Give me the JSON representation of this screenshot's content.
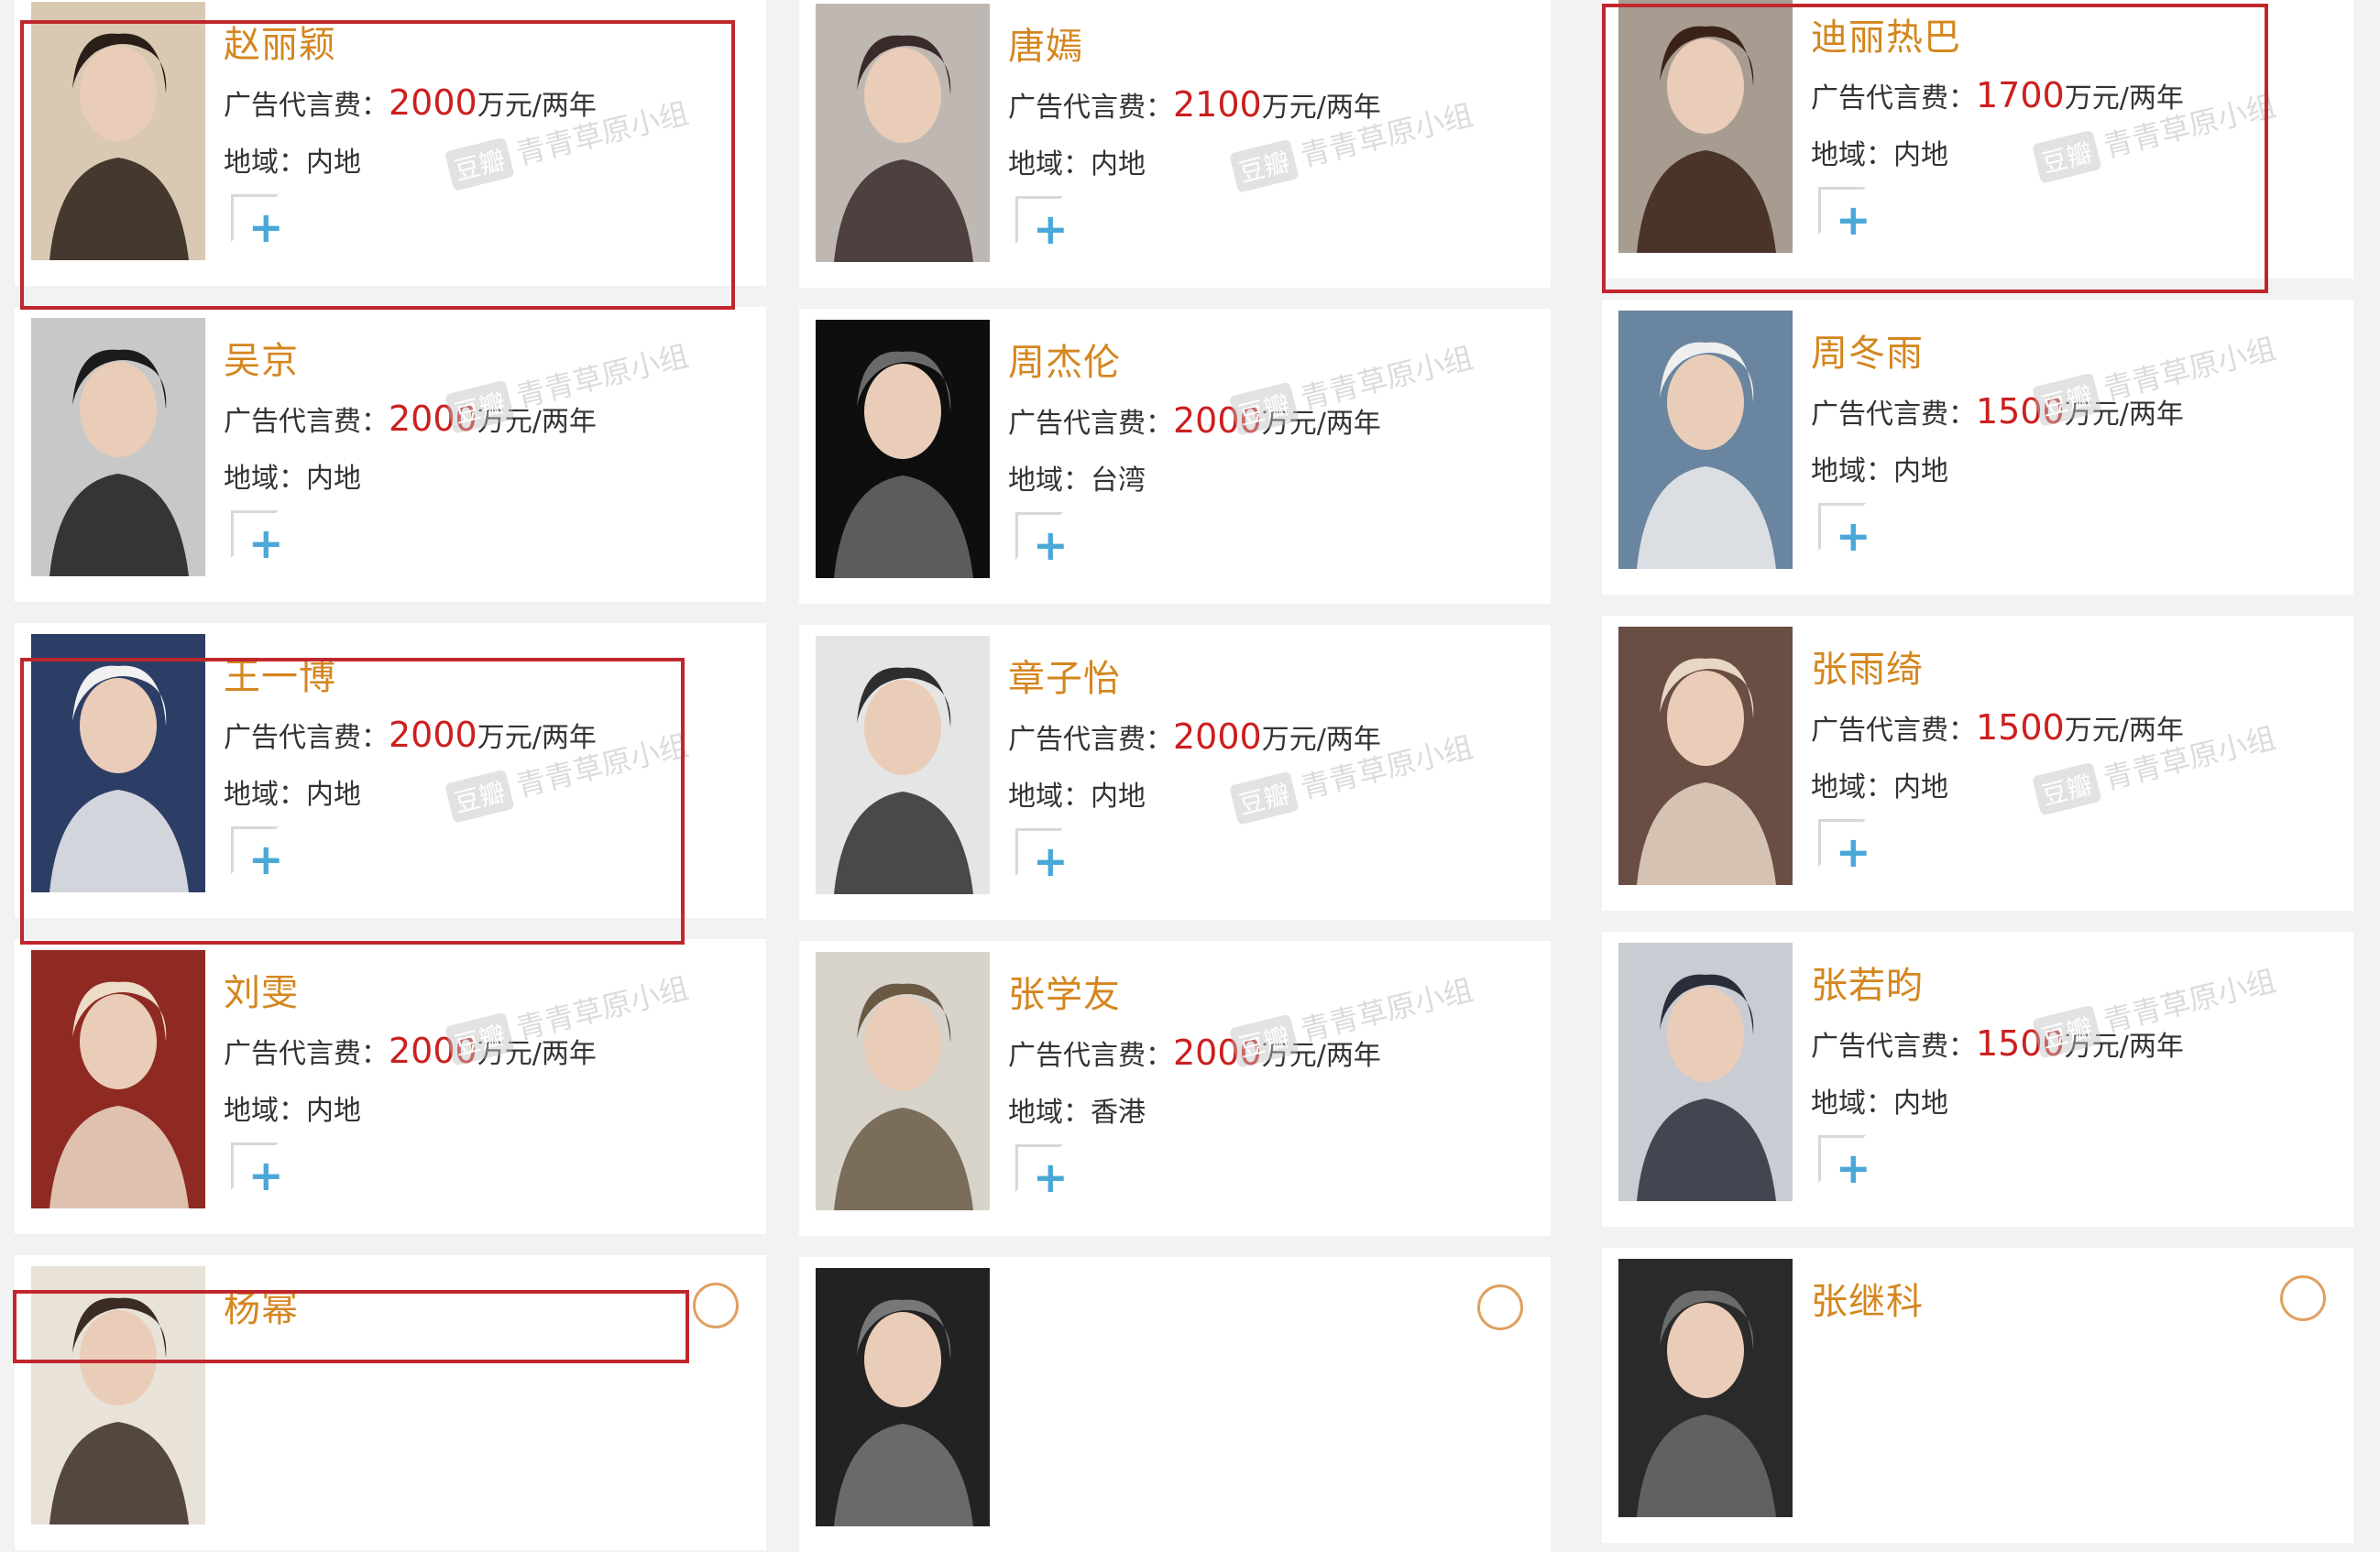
{
  "watermark": {
    "badge": "豆瓣",
    "text": "青青草原小组"
  },
  "labels": {
    "fee_label": "广告代言费：",
    "region_label": "地域：",
    "unit": "万元/两年",
    "add": "+"
  },
  "columns": [
    {
      "cards": [
        {
          "name": "赵丽颖",
          "fee": "2000",
          "region": "内地",
          "highlighted": true
        },
        {
          "name": "吴京",
          "fee": "2000",
          "region": "内地",
          "highlighted": false
        },
        {
          "name": "王一博",
          "fee": "2000",
          "region": "内地",
          "highlighted": true
        },
        {
          "name": "刘雯",
          "fee": "2000",
          "region": "内地",
          "highlighted": false
        },
        {
          "name": "杨幂",
          "fee": "",
          "region": "",
          "highlighted": true
        }
      ]
    },
    {
      "cards": [
        {
          "name": "唐嫣",
          "fee": "2100",
          "region": "内地",
          "highlighted": false
        },
        {
          "name": "周杰伦",
          "fee": "2000",
          "region": "台湾",
          "highlighted": false
        },
        {
          "name": "章子怡",
          "fee": "2000",
          "region": "内地",
          "highlighted": false
        },
        {
          "name": "张学友",
          "fee": "2000",
          "region": "香港",
          "highlighted": false
        },
        {
          "name": "",
          "fee": "",
          "region": "",
          "highlighted": false
        }
      ]
    },
    {
      "cards": [
        {
          "name": "迪丽热巴",
          "fee": "1700",
          "region": "内地",
          "highlighted": true
        },
        {
          "name": "周冬雨",
          "fee": "1500",
          "region": "内地",
          "highlighted": false
        },
        {
          "name": "张雨绮",
          "fee": "1500",
          "region": "内地",
          "highlighted": false
        },
        {
          "name": "张若昀",
          "fee": "1500",
          "region": "内地",
          "highlighted": false
        },
        {
          "name": "张继科",
          "fee": "",
          "region": "",
          "highlighted": false
        }
      ]
    }
  ],
  "colors": {
    "name": "#d4861f",
    "fee_value": "#cc1f1f",
    "highlight_border": "#c0272d",
    "plus": "#4aa8d8",
    "card_bg": "#ffffff",
    "page_bg": "#f2f2f2"
  }
}
